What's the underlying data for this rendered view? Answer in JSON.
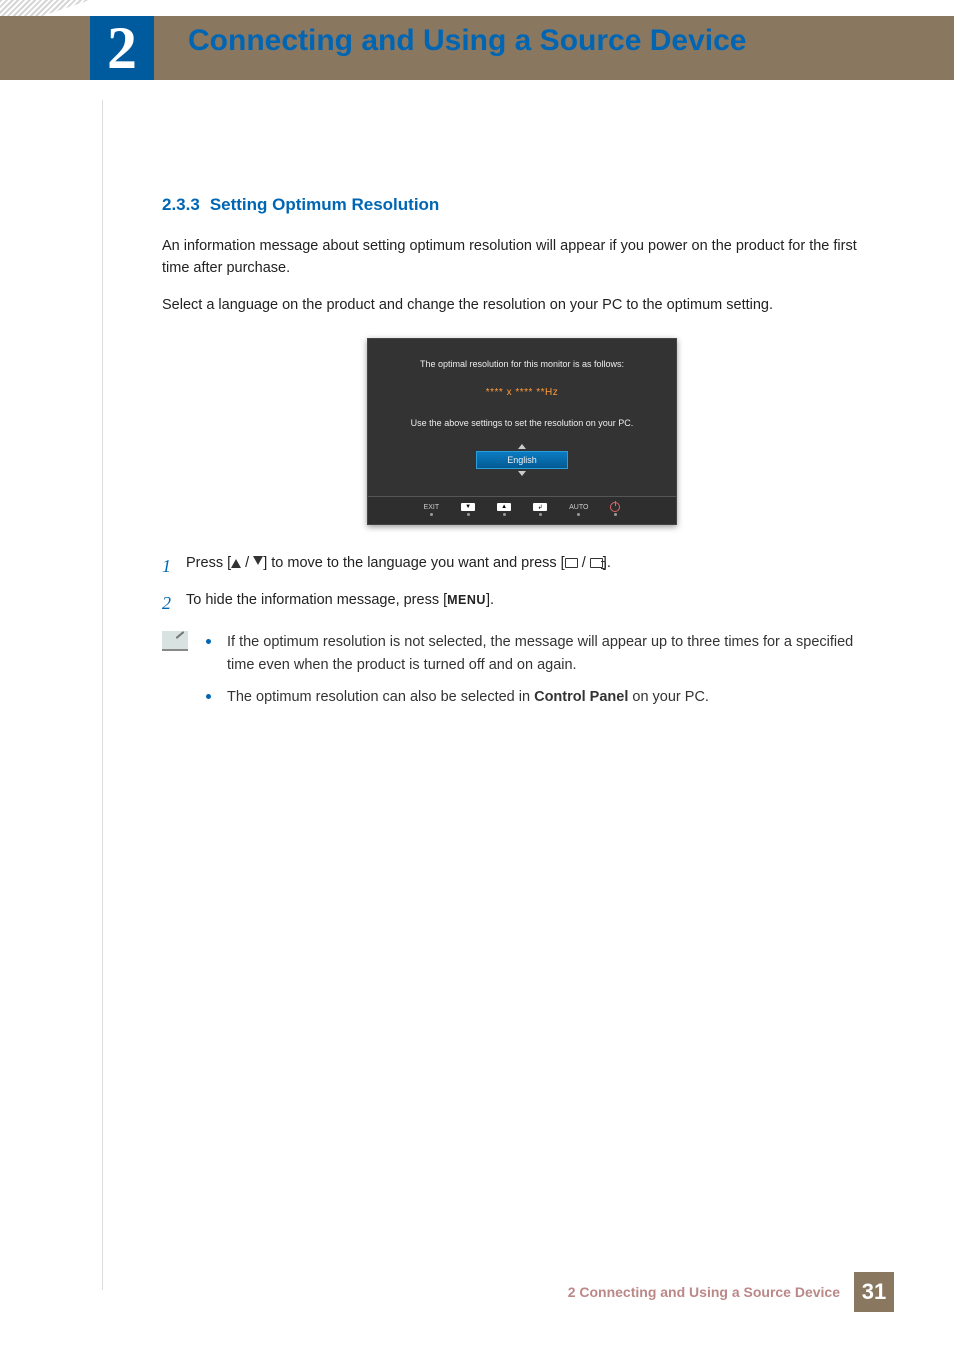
{
  "header": {
    "chapter_number": "2",
    "chapter_title": "Connecting and Using a Source Device"
  },
  "section": {
    "number": "2.3.3",
    "title": "Setting Optimum Resolution"
  },
  "intro_p1": "An information message about setting optimum resolution will appear if you power on the product for the first time after purchase.",
  "intro_p2": "Select a language on the product and change the resolution on your PC to the optimum setting.",
  "osd": {
    "line1": "The optimal resolution for this monitor is as follows:",
    "resolution": "**** x ****  **Hz",
    "line2": "Use the above settings to set the resolution on your PC.",
    "language": "English",
    "buttons": {
      "exit": "EXIT",
      "auto": "AUTO"
    }
  },
  "steps": {
    "s1_a": "Press [",
    "s1_slash": " / ",
    "s1_b": "] to move to the language you want and press [",
    "s1_slash2": " / ",
    "s1_c": "].",
    "s2_a": "To hide the information message, press [",
    "s2_menu": "MENU",
    "s2_b": "]."
  },
  "notes": {
    "n1": "If the optimum resolution is not selected, the message will appear up to three times for a specified time even when the product is turned off and on again.",
    "n2_a": "The optimum resolution can also be selected in ",
    "n2_bold": "Control Panel",
    "n2_b": " on your PC."
  },
  "footer": {
    "text": "2 Connecting and Using a Source Device",
    "page": "31"
  }
}
